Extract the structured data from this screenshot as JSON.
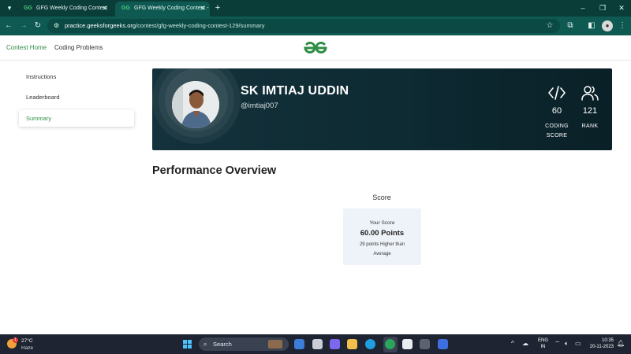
{
  "browser": {
    "tabs": [
      {
        "title": "GFG Weekly Coding Contest",
        "active": false
      },
      {
        "title": "GFG Weekly Coding Contest -",
        "active": true
      }
    ],
    "url_host": "practice.geeksforgeeks.org",
    "url_path": "/contest/gfg-weekly-coding-contest-129/summary"
  },
  "site": {
    "nav": [
      "Contest Home",
      "Coding Problems"
    ],
    "logo_text": "GfG",
    "accent_color": "#2f8d46"
  },
  "sidebar": {
    "items": [
      {
        "label": "Instructions",
        "active": false
      },
      {
        "label": "Leaderboard",
        "active": false
      },
      {
        "label": "Summary",
        "active": true
      }
    ]
  },
  "profile": {
    "name": "SK IMTIAJ UDDIN",
    "handle": "@imtiaj007",
    "stats": [
      {
        "icon": "code-icon",
        "value": "60",
        "label": "CODING\nSCORE"
      },
      {
        "icon": "users-icon",
        "value": "121",
        "label": "RANK"
      }
    ]
  },
  "performance": {
    "title": "Performance Overview",
    "score_heading": "Score",
    "your_score_label": "Your Score",
    "points": "60.00 Points",
    "comparison": "29 points Higher than Average"
  },
  "taskbar": {
    "temperature": "27°C",
    "weather": "Haze",
    "weather_badge": "1",
    "search_placeholder": "Search",
    "language": "ENG",
    "region": "IN",
    "time": "10:35",
    "date": "20-11-2023"
  }
}
